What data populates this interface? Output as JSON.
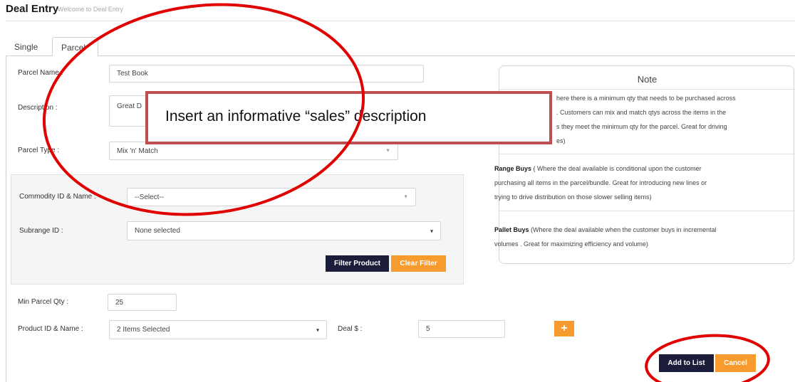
{
  "header": {
    "title": "Deal Entry",
    "subtitle": "Welcome to Deal Entry"
  },
  "tabs": [
    {
      "label": "Single"
    },
    {
      "label": "Parcel"
    }
  ],
  "form": {
    "parcel_name": {
      "label": "Parcel Name :",
      "value": "Test Book"
    },
    "description": {
      "label": "Description :",
      "value": "Great D"
    },
    "parcel_type": {
      "label": "Parcel Type :",
      "value": "Mix 'n' Match"
    },
    "commodity": {
      "label": "Commodity ID & Name :",
      "value": "--Select--"
    },
    "subrange": {
      "label": "Subrange ID :",
      "value": "None selected"
    },
    "filter_button": "Filter Product",
    "clear_button": "Clear Filter",
    "min_qty": {
      "label": "Min Parcel Qty :",
      "value": "25"
    },
    "product": {
      "label": "Product ID & Name :",
      "value": "2 Items Selected"
    },
    "deal": {
      "label": "Deal $ :",
      "value": "5"
    },
    "add_icon": "plus-icon",
    "add_to_list_button": "Add to List",
    "cancel_button": "Cancel"
  },
  "note": {
    "title": "Note",
    "mix_line1": "here there is a minimum qty that needs to be purchased across",
    "mix_line2": ". Customers can mix and match qtys across the items in the",
    "mix_line3": "s they meet the minimum qty for the parcel. Great for driving",
    "mix_line4": "es)",
    "range_title": "Range Buys",
    "range_line1": " ( Where the deal available is conditional upon the customer",
    "range_line2": "purchasing all items in the parcel/bundle. Great for introducing new lines or",
    "range_line3": "trying to drive distribution on those slower selling items)",
    "pallet_title": "Pallet Buys",
    "pallet_line1": " (Where the deal available when the customer buys in incremental",
    "pallet_line2": "volumes . Great for maximizing efficiency and volume)"
  },
  "callout": {
    "text": "Insert an informative “sales” description"
  },
  "colors": {
    "navy": "#1c1d3a",
    "orange": "#f79b2e",
    "annotation_red": "#e00000",
    "callout_border": "#bf4f4f"
  }
}
